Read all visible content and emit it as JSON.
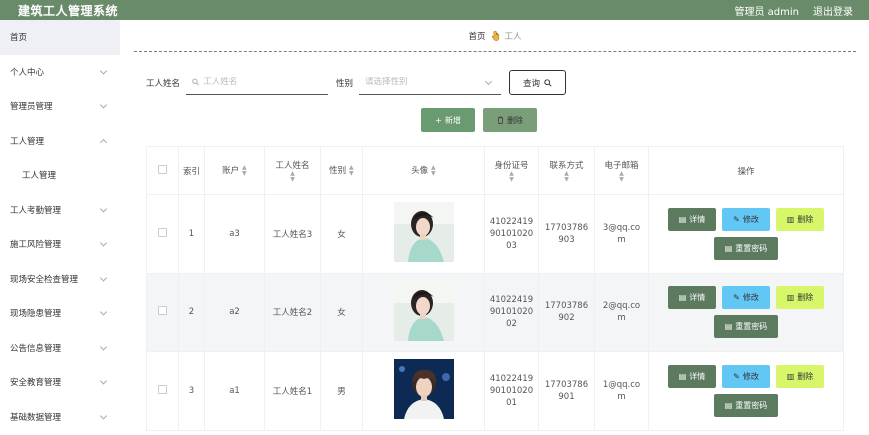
{
  "header": {
    "title": "建筑工人管理系统",
    "user": "管理员 admin",
    "logout": "退出登录"
  },
  "sidebar": {
    "items": [
      {
        "label": "首页"
      },
      {
        "label": "个人中心"
      },
      {
        "label": "管理员管理"
      },
      {
        "label": "工人管理"
      },
      {
        "label": "工人管理"
      },
      {
        "label": "工人考勤管理"
      },
      {
        "label": "施工风险管理"
      },
      {
        "label": "现场安全检查管理"
      },
      {
        "label": "现场隐患管理"
      },
      {
        "label": "公告信息管理"
      },
      {
        "label": "安全教育管理"
      },
      {
        "label": "基础数据管理"
      }
    ]
  },
  "breadcrumb": {
    "home": "首页",
    "current": "工人"
  },
  "search": {
    "name_label": "工人姓名",
    "name_placeholder": "工人姓名",
    "gender_label": "性别",
    "gender_placeholder": "请选择性别",
    "query": "查询"
  },
  "actions": {
    "add": "新增",
    "delete": "删除"
  },
  "table": {
    "headers": {
      "index": "索引",
      "account": "账户",
      "name": "工人姓名",
      "gender": "性别",
      "avatar": "头像",
      "idcard": "身份证号",
      "phone": "联系方式",
      "email": "电子邮箱",
      "ops": "操作"
    },
    "rows": [
      {
        "index": "1",
        "account": "a3",
        "name": "工人姓名3",
        "gender": "女",
        "idcard_1": "41022419",
        "idcard_2": "90101020",
        "idcard_3": "03",
        "phone_1": "17703786",
        "phone_2": "903",
        "email_1": "3@qq.co",
        "email_2": "m"
      },
      {
        "index": "2",
        "account": "a2",
        "name": "工人姓名2",
        "gender": "女",
        "idcard_1": "41022419",
        "idcard_2": "90101020",
        "idcard_3": "02",
        "phone_1": "17703786",
        "phone_2": "902",
        "email_1": "2@qq.co",
        "email_2": "m"
      },
      {
        "index": "3",
        "account": "a1",
        "name": "工人姓名1",
        "gender": "男",
        "idcard_1": "41022419",
        "idcard_2": "90101020",
        "idcard_3": "01",
        "phone_1": "17703786",
        "phone_2": "901",
        "email_1": "1@qq.co",
        "email_2": "m"
      }
    ],
    "op_labels": {
      "detail": "详情",
      "edit": "修改",
      "delete": "删除",
      "reset": "重置密码"
    }
  },
  "colors": {
    "header_bg": "#6a8b6a",
    "detail_btn": "#5b7a5e",
    "edit_btn": "#62c7f5",
    "delete_btn": "#d7f66a"
  }
}
